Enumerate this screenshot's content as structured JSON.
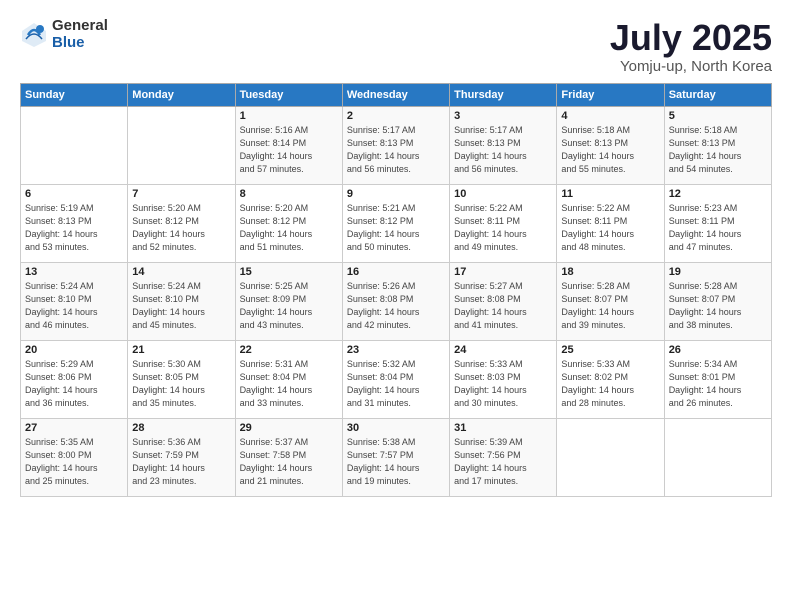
{
  "logo": {
    "general": "General",
    "blue": "Blue"
  },
  "title": "July 2025",
  "subtitle": "Yomju-up, North Korea",
  "headers": [
    "Sunday",
    "Monday",
    "Tuesday",
    "Wednesday",
    "Thursday",
    "Friday",
    "Saturday"
  ],
  "weeks": [
    [
      {
        "day": "",
        "detail": ""
      },
      {
        "day": "",
        "detail": ""
      },
      {
        "day": "1",
        "detail": "Sunrise: 5:16 AM\nSunset: 8:14 PM\nDaylight: 14 hours\nand 57 minutes."
      },
      {
        "day": "2",
        "detail": "Sunrise: 5:17 AM\nSunset: 8:13 PM\nDaylight: 14 hours\nand 56 minutes."
      },
      {
        "day": "3",
        "detail": "Sunrise: 5:17 AM\nSunset: 8:13 PM\nDaylight: 14 hours\nand 56 minutes."
      },
      {
        "day": "4",
        "detail": "Sunrise: 5:18 AM\nSunset: 8:13 PM\nDaylight: 14 hours\nand 55 minutes."
      },
      {
        "day": "5",
        "detail": "Sunrise: 5:18 AM\nSunset: 8:13 PM\nDaylight: 14 hours\nand 54 minutes."
      }
    ],
    [
      {
        "day": "6",
        "detail": "Sunrise: 5:19 AM\nSunset: 8:13 PM\nDaylight: 14 hours\nand 53 minutes."
      },
      {
        "day": "7",
        "detail": "Sunrise: 5:20 AM\nSunset: 8:12 PM\nDaylight: 14 hours\nand 52 minutes."
      },
      {
        "day": "8",
        "detail": "Sunrise: 5:20 AM\nSunset: 8:12 PM\nDaylight: 14 hours\nand 51 minutes."
      },
      {
        "day": "9",
        "detail": "Sunrise: 5:21 AM\nSunset: 8:12 PM\nDaylight: 14 hours\nand 50 minutes."
      },
      {
        "day": "10",
        "detail": "Sunrise: 5:22 AM\nSunset: 8:11 PM\nDaylight: 14 hours\nand 49 minutes."
      },
      {
        "day": "11",
        "detail": "Sunrise: 5:22 AM\nSunset: 8:11 PM\nDaylight: 14 hours\nand 48 minutes."
      },
      {
        "day": "12",
        "detail": "Sunrise: 5:23 AM\nSunset: 8:11 PM\nDaylight: 14 hours\nand 47 minutes."
      }
    ],
    [
      {
        "day": "13",
        "detail": "Sunrise: 5:24 AM\nSunset: 8:10 PM\nDaylight: 14 hours\nand 46 minutes."
      },
      {
        "day": "14",
        "detail": "Sunrise: 5:24 AM\nSunset: 8:10 PM\nDaylight: 14 hours\nand 45 minutes."
      },
      {
        "day": "15",
        "detail": "Sunrise: 5:25 AM\nSunset: 8:09 PM\nDaylight: 14 hours\nand 43 minutes."
      },
      {
        "day": "16",
        "detail": "Sunrise: 5:26 AM\nSunset: 8:08 PM\nDaylight: 14 hours\nand 42 minutes."
      },
      {
        "day": "17",
        "detail": "Sunrise: 5:27 AM\nSunset: 8:08 PM\nDaylight: 14 hours\nand 41 minutes."
      },
      {
        "day": "18",
        "detail": "Sunrise: 5:28 AM\nSunset: 8:07 PM\nDaylight: 14 hours\nand 39 minutes."
      },
      {
        "day": "19",
        "detail": "Sunrise: 5:28 AM\nSunset: 8:07 PM\nDaylight: 14 hours\nand 38 minutes."
      }
    ],
    [
      {
        "day": "20",
        "detail": "Sunrise: 5:29 AM\nSunset: 8:06 PM\nDaylight: 14 hours\nand 36 minutes."
      },
      {
        "day": "21",
        "detail": "Sunrise: 5:30 AM\nSunset: 8:05 PM\nDaylight: 14 hours\nand 35 minutes."
      },
      {
        "day": "22",
        "detail": "Sunrise: 5:31 AM\nSunset: 8:04 PM\nDaylight: 14 hours\nand 33 minutes."
      },
      {
        "day": "23",
        "detail": "Sunrise: 5:32 AM\nSunset: 8:04 PM\nDaylight: 14 hours\nand 31 minutes."
      },
      {
        "day": "24",
        "detail": "Sunrise: 5:33 AM\nSunset: 8:03 PM\nDaylight: 14 hours\nand 30 minutes."
      },
      {
        "day": "25",
        "detail": "Sunrise: 5:33 AM\nSunset: 8:02 PM\nDaylight: 14 hours\nand 28 minutes."
      },
      {
        "day": "26",
        "detail": "Sunrise: 5:34 AM\nSunset: 8:01 PM\nDaylight: 14 hours\nand 26 minutes."
      }
    ],
    [
      {
        "day": "27",
        "detail": "Sunrise: 5:35 AM\nSunset: 8:00 PM\nDaylight: 14 hours\nand 25 minutes."
      },
      {
        "day": "28",
        "detail": "Sunrise: 5:36 AM\nSunset: 7:59 PM\nDaylight: 14 hours\nand 23 minutes."
      },
      {
        "day": "29",
        "detail": "Sunrise: 5:37 AM\nSunset: 7:58 PM\nDaylight: 14 hours\nand 21 minutes."
      },
      {
        "day": "30",
        "detail": "Sunrise: 5:38 AM\nSunset: 7:57 PM\nDaylight: 14 hours\nand 19 minutes."
      },
      {
        "day": "31",
        "detail": "Sunrise: 5:39 AM\nSunset: 7:56 PM\nDaylight: 14 hours\nand 17 minutes."
      },
      {
        "day": "",
        "detail": ""
      },
      {
        "day": "",
        "detail": ""
      }
    ]
  ]
}
